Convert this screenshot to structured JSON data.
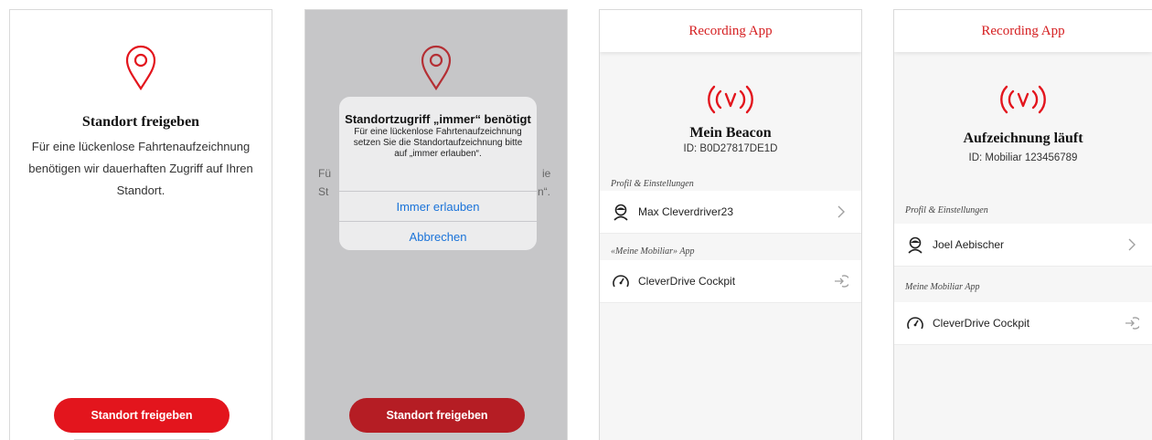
{
  "screen1": {
    "title": "Standort freigeben",
    "description_lines": [
      "Für eine lückenlose Fahrtenaufzeichnung",
      "benötigen wir dauerhaften Zugriff auf Ihren",
      "Standort."
    ],
    "button_label": "Standort freigeben"
  },
  "screen2": {
    "background_fragments": [
      "Fü",
      "St",
      "ie",
      "n“."
    ],
    "dialog": {
      "title": "Standortzugriff „immer“ benötigt",
      "message_lines": [
        "Für eine lückenlose Fahrtenaufzeichnung",
        "setzen Sie die Standortaufzeichnung bitte",
        "auf „immer erlauben“."
      ],
      "primary_action": "Immer erlauben",
      "secondary_action": "Abbrechen"
    },
    "button_label": "Standort freigeben"
  },
  "screen3": {
    "app_title": "Recording App",
    "beacon_title": "Mein Beacon",
    "beacon_id": "ID: B0D27817DE1D",
    "section1_label": "Profil & Einstellungen",
    "profile_name": "Max Cleverdriver23",
    "section2_label": "«Meine Mobiliar» App",
    "cockpit_label": "CleverDrive Cockpit"
  },
  "screen4": {
    "app_title": "Recording App",
    "status_title": "Aufzeichnung läuft",
    "record_id": "ID: Mobiliar 123456789",
    "section1_label": "Profil & Einstellungen",
    "profile_name": "Joel Aebischer",
    "section2_label": "Meine Mobiliar App",
    "cockpit_label": "CleverDrive Cockpit"
  },
  "colors": {
    "accent_red": "#e3151d",
    "brand_red": "#d51e20",
    "link_blue": "#1a73d9"
  },
  "icons": [
    "location-pin-icon",
    "beacon-signal-icon",
    "user-avatar-icon",
    "speedometer-icon",
    "chevron-right-icon",
    "open-external-icon"
  ]
}
